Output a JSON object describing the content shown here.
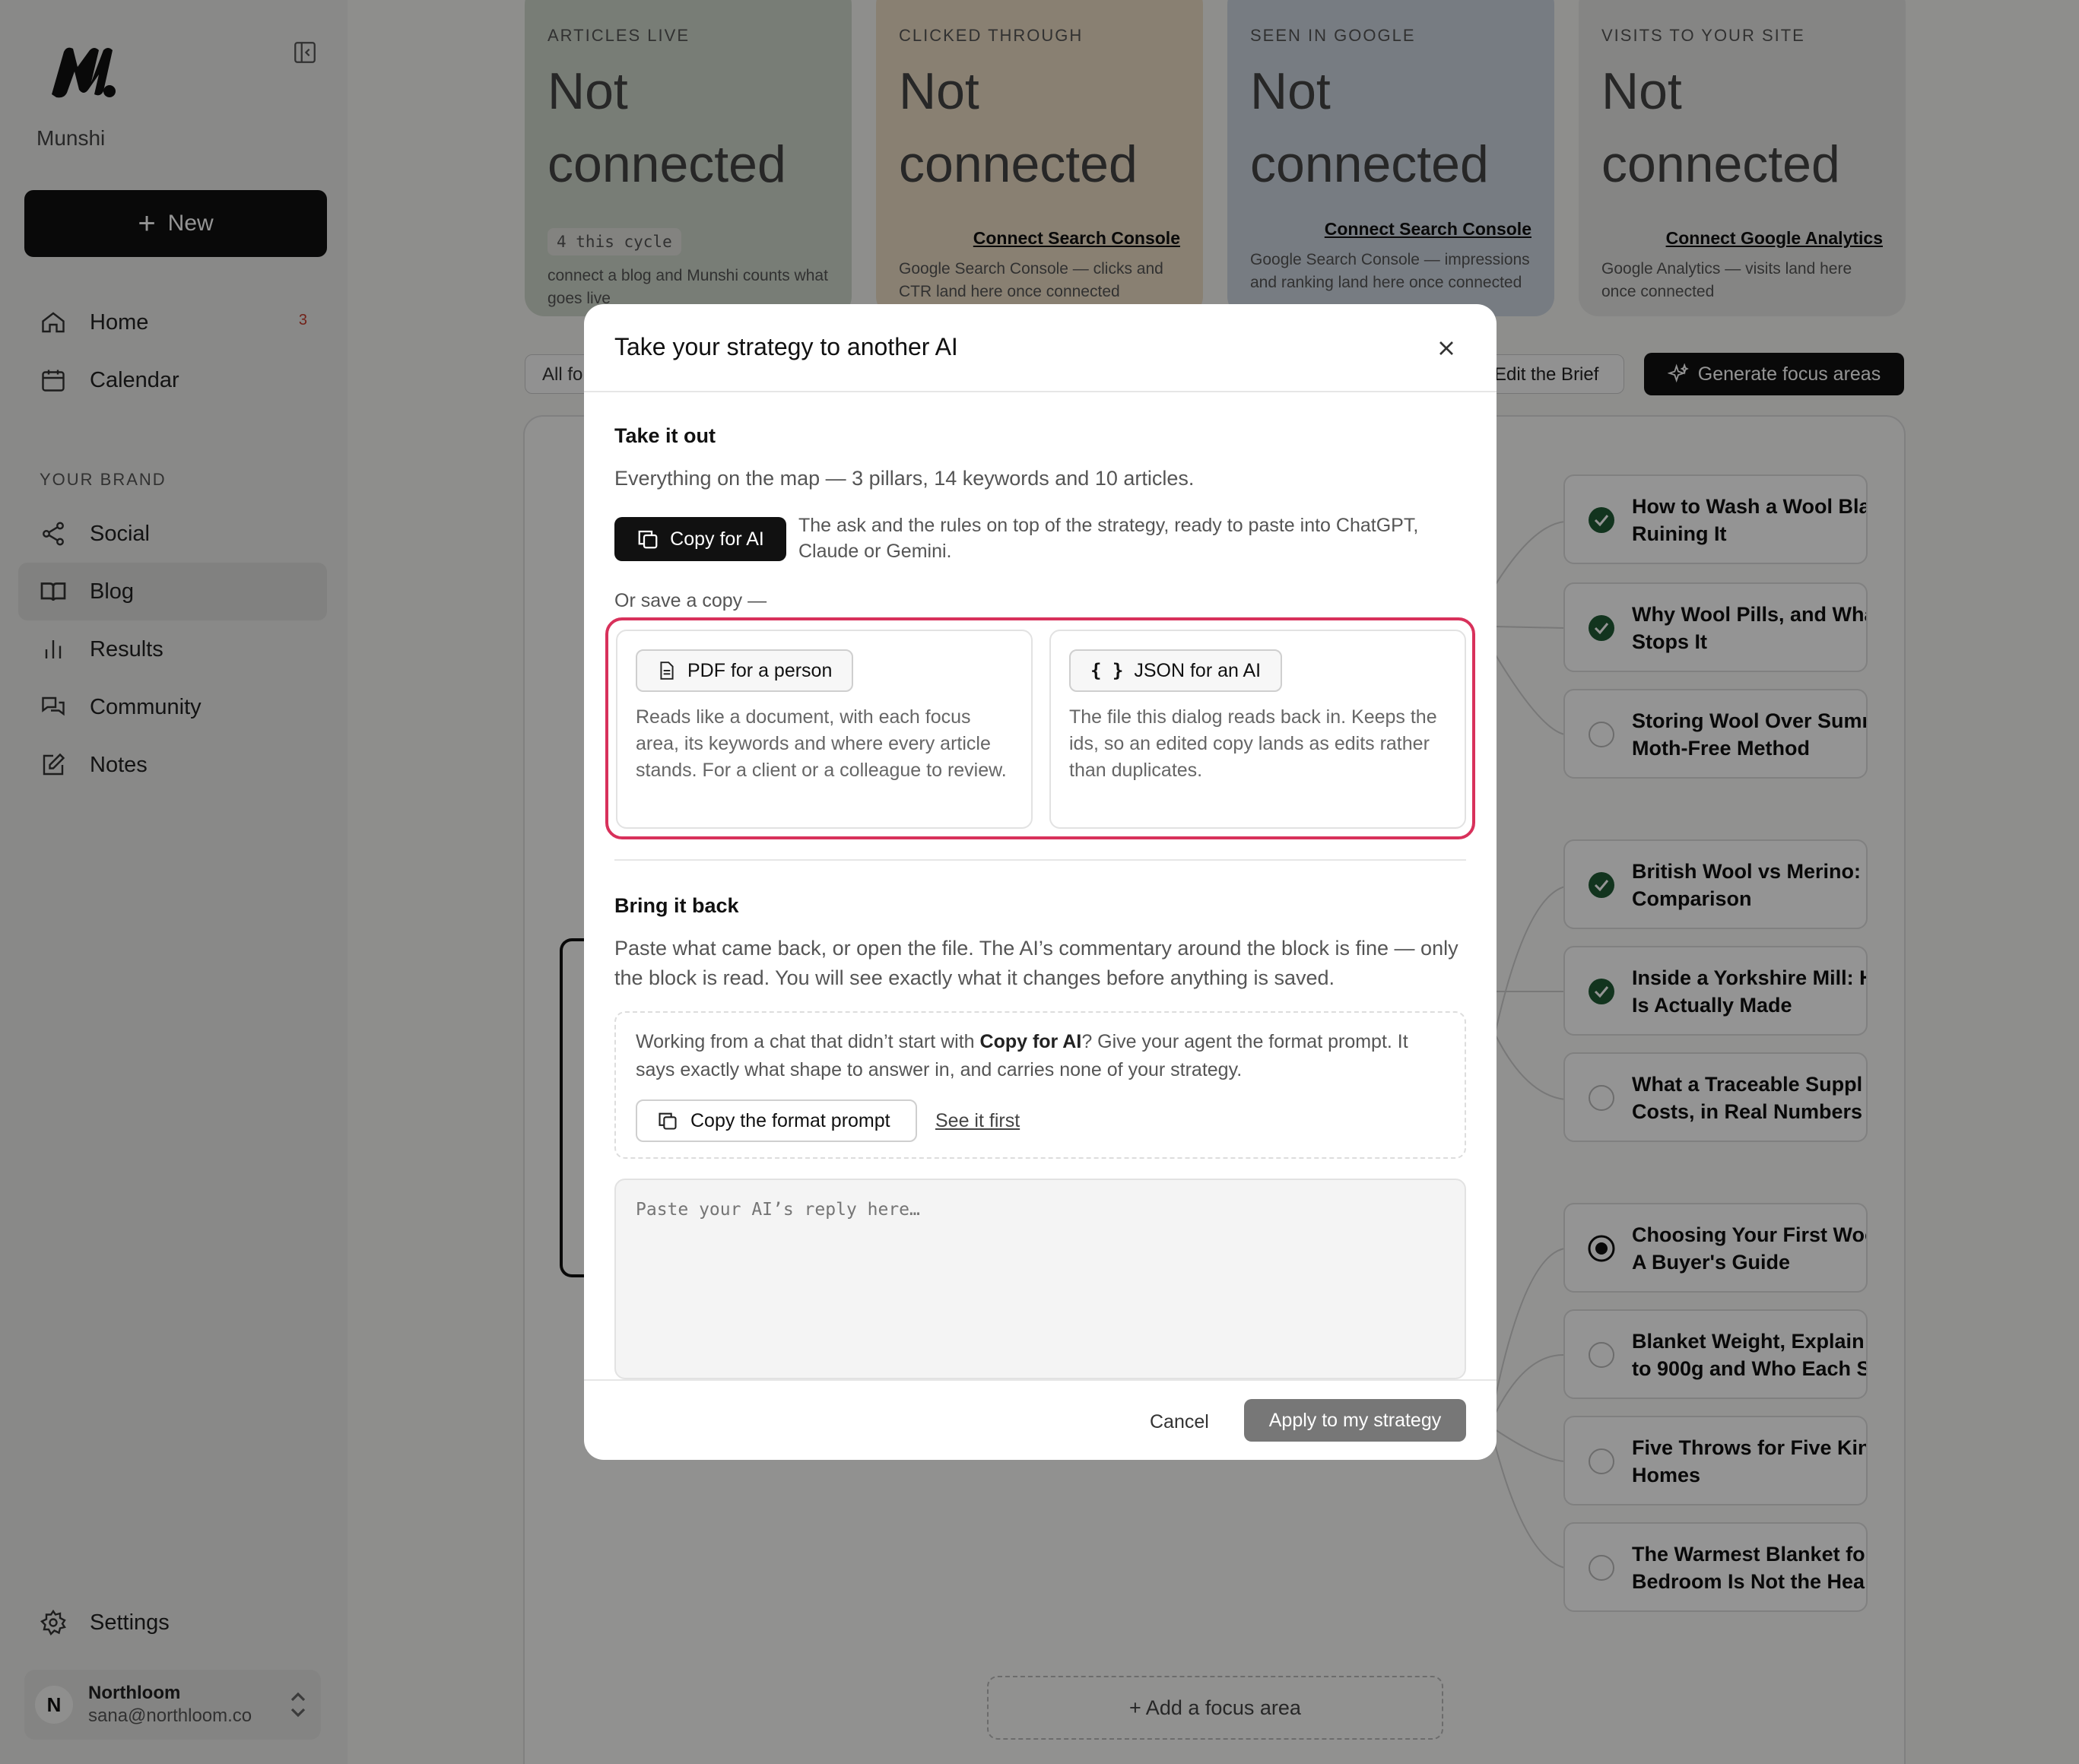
{
  "sidebar": {
    "brand": "Munshi",
    "new_label": "New",
    "nav": [
      {
        "label": "Home",
        "badge": "3"
      },
      {
        "label": "Calendar"
      }
    ],
    "section_label": "YOUR BRAND",
    "brand_nav": [
      {
        "label": "Social"
      },
      {
        "label": "Blog"
      },
      {
        "label": "Results"
      },
      {
        "label": "Community"
      },
      {
        "label": "Notes"
      }
    ],
    "settings_label": "Settings",
    "account": {
      "initial": "N",
      "name": "Northloom",
      "email": "sana@northloom.co"
    }
  },
  "stats": [
    {
      "label": "ARTICLES LIVE",
      "value": "Not connected",
      "pill": "4 this cycle",
      "desc": "connect a blog and Munshi counts what goes live",
      "color": "#cfd8cb"
    },
    {
      "label": "CLICKED THROUGH",
      "value": "Not connected",
      "link": "Connect Search Console",
      "desc": "Google Search Console — clicks and CTR land here once connected",
      "color": "#ecdcc4"
    },
    {
      "label": "SEEN IN GOOGLE",
      "value": "Not connected",
      "link": "Connect Search Console",
      "desc": "Google Search Console — impressions and ranking land here once connected",
      "color": "#cdd6e0"
    },
    {
      "label": "VISITS TO YOUR SITE",
      "value": "Not connected",
      "link": "Connect Google Analytics",
      "desc": "Google Analytics — visits land here once connected",
      "color": "#e6e6e4"
    }
  ],
  "toolbar": {
    "all_focus": "All fo",
    "edit_brief": "Edit the Brief",
    "generate": "Generate focus areas"
  },
  "map_articles": [
    {
      "title": "How to Wash a Wool Bla",
      "title2": "Ruining It",
      "status": "done"
    },
    {
      "title": "Why Wool Pills, and Wha",
      "title2": "Stops It",
      "status": "done"
    },
    {
      "title": "Storing Wool Over Sumr",
      "title2": "Moth-Free Method",
      "status": "empty"
    },
    {
      "title": "British Wool vs Merino: /",
      "title2": "Comparison",
      "status": "done"
    },
    {
      "title": "Inside a Yorkshire Mill: H",
      "title2": "Is Actually Made",
      "status": "done"
    },
    {
      "title": "What a Traceable Suppl",
      "title2": "Costs, in Real Numbers",
      "status": "empty"
    },
    {
      "title": "Choosing Your First Woo",
      "title2": "A Buyer's Guide",
      "status": "selected"
    },
    {
      "title": "Blanket Weight, Explain",
      "title2": "to 900g and Who Each S",
      "status": "empty"
    },
    {
      "title": "Five Throws for Five Kin",
      "title2": "Homes",
      "status": "empty"
    },
    {
      "title": "The Warmest Blanket fo",
      "title2": "Bedroom Is Not the Hea",
      "status": "empty"
    }
  ],
  "add_focus": "+ Add a focus area",
  "modal": {
    "title": "Take your strategy to another AI",
    "take_out": "Take it out",
    "summary": "Everything on the map — 3 pillars, 14 keywords and 10 articles.",
    "copy_ai": "Copy for AI",
    "copy_ai_desc": "The ask and the rules on top of the strategy, ready to paste into ChatGPT, Claude or Gemini.",
    "save_copy": "Or save a copy —",
    "pdf": {
      "label": "PDF for a person",
      "desc": "Reads like a document, with each focus area, its keywords and where every article stands. For a client or a colleague to review."
    },
    "json": {
      "label": "JSON for an AI",
      "desc": "The file this dialog reads back in. Keeps the ids, so an edited copy lands as edits rather than duplicates."
    },
    "bring_back": "Bring it back",
    "bring_desc": "Paste what came back, or open the file. The AI’s commentary around the block is fine — only the block is read. You will see exactly what it changes before anything is saved.",
    "chat_note_pre": "Working from a chat that didn’t start with ",
    "chat_note_bold": "Copy for AI",
    "chat_note_post": "? Give your agent the format prompt. It says exactly what shape to answer in, and carries none of your strategy.",
    "copy_format": "Copy the format prompt",
    "see_first": "See it first",
    "reply_placeholder": "Paste your AI’s reply here…",
    "cancel": "Cancel",
    "apply": "Apply to my strategy"
  },
  "colors": {
    "accent": "#111111",
    "highlight": "#d8315b",
    "check": "#1f5a34"
  }
}
